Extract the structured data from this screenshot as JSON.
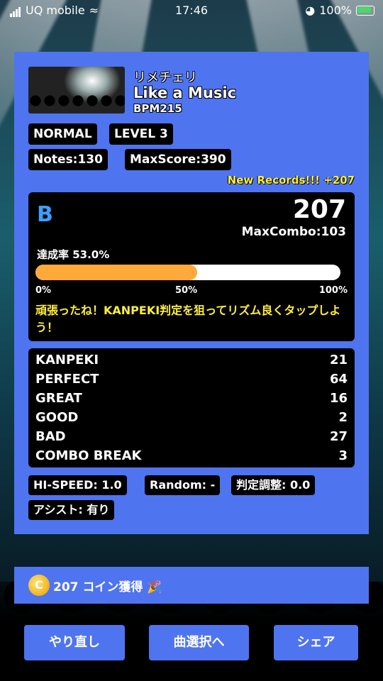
{
  "status_bar": {
    "carrier": "UQ mobile",
    "time": "17:46",
    "battery": "100%"
  },
  "song": {
    "artist": "リメチェリ",
    "title": "Like a Music",
    "bpm": "BPM215"
  },
  "tags": {
    "difficulty": "NORMAL",
    "level": "LEVEL 3",
    "notes": "Notes:130",
    "max_score": "MaxScore:390"
  },
  "new_records": "New Records!!! +207",
  "result": {
    "rank": "B",
    "score": "207",
    "max_combo": "MaxCombo:103",
    "achievement_label": "達成率  53.0%",
    "achievement_ratio": 0.53,
    "ticks": [
      "0%",
      "50%",
      "100%"
    ],
    "advice": "頑張ったね！KANPEKI判定を狙ってリズム良くタップしよう！"
  },
  "judgements": [
    {
      "label": "KANPEKI",
      "count": "21"
    },
    {
      "label": "PERFECT",
      "count": "64"
    },
    {
      "label": "GREAT",
      "count": "16"
    },
    {
      "label": "GOOD",
      "count": "2"
    },
    {
      "label": "BAD",
      "count": "27"
    },
    {
      "label": "COMBO BREAK",
      "count": "3"
    }
  ],
  "settings": {
    "hispeed": "HI-SPEED: 1.0",
    "random": "Random: -",
    "judge_adjust": "判定調整: 0.0",
    "assist": "アシスト: 有り"
  },
  "coins": {
    "icon": "C",
    "text": "207 コイン獲得 🎉"
  },
  "buttons": {
    "retry": "やり直し",
    "song_select": "曲選択へ",
    "share": "シェア"
  }
}
